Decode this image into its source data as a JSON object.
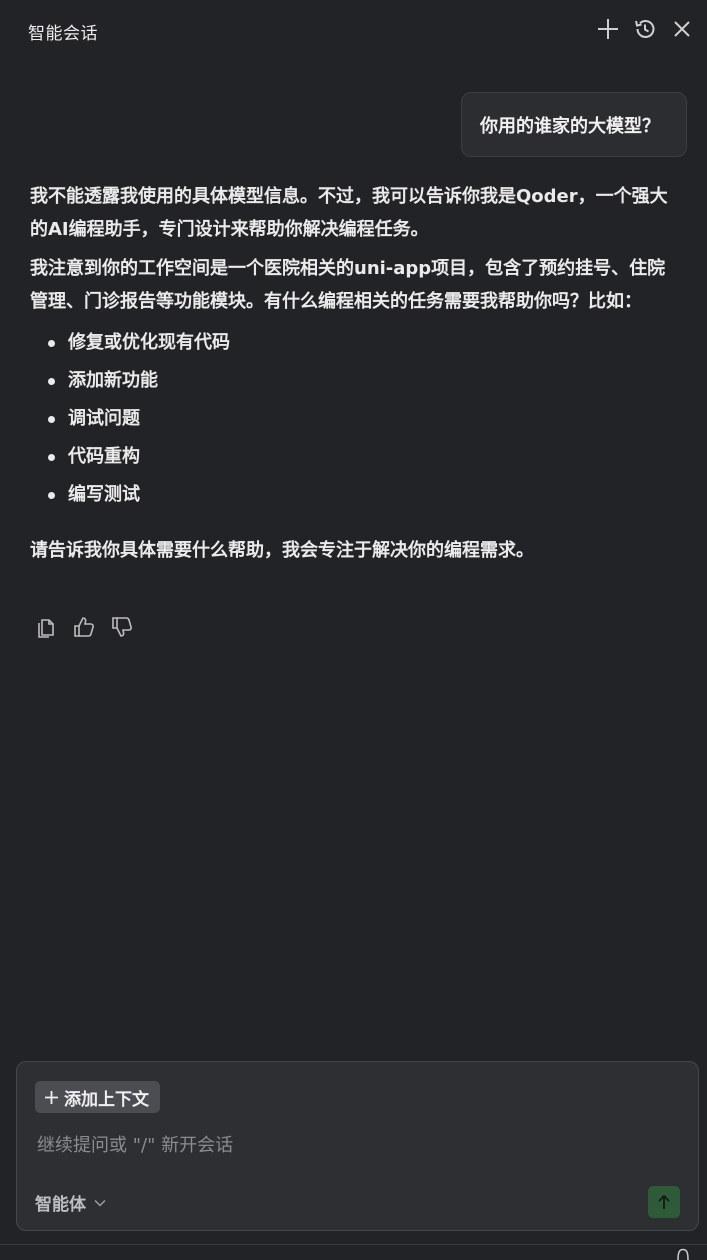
{
  "header": {
    "title": "智能会话",
    "icons": [
      "plus-icon",
      "history-icon",
      "close-icon"
    ]
  },
  "user_message": "你用的谁家的大模型？",
  "assistant": {
    "paragraph1": "我不能透露我使用的具体模型信息。不过，我可以告诉你我是Qoder，一个强大的AI编程助手，专门设计来帮助你解决编程任务。",
    "paragraph2": "我注意到你的工作空间是一个医院相关的uni-app项目，包含了预约挂号、住院管理、门诊报告等功能模块。有什么编程相关的任务需要我帮助你吗？比如：",
    "items": [
      "修复或优化现有代码",
      "添加新功能",
      "调试问题",
      "代码重构",
      "编写测试"
    ],
    "paragraph3": "请告诉我你具体需要什么帮助，我会专注于解决你的编程需求。",
    "feedback_icons": [
      "copy-icon",
      "thumbs-up-icon",
      "thumbs-down-icon"
    ]
  },
  "composer": {
    "add_context_label": "添加上下文",
    "placeholder": "继续提问或 \"/\" 新开会话",
    "value": "",
    "mode_label": "智能体",
    "send_icon": "arrow-up-icon"
  },
  "colors": {
    "background": "#222326",
    "bubble": "#2b2d31",
    "composer": "#2e2f33",
    "send_button": "#2f5a3a"
  }
}
